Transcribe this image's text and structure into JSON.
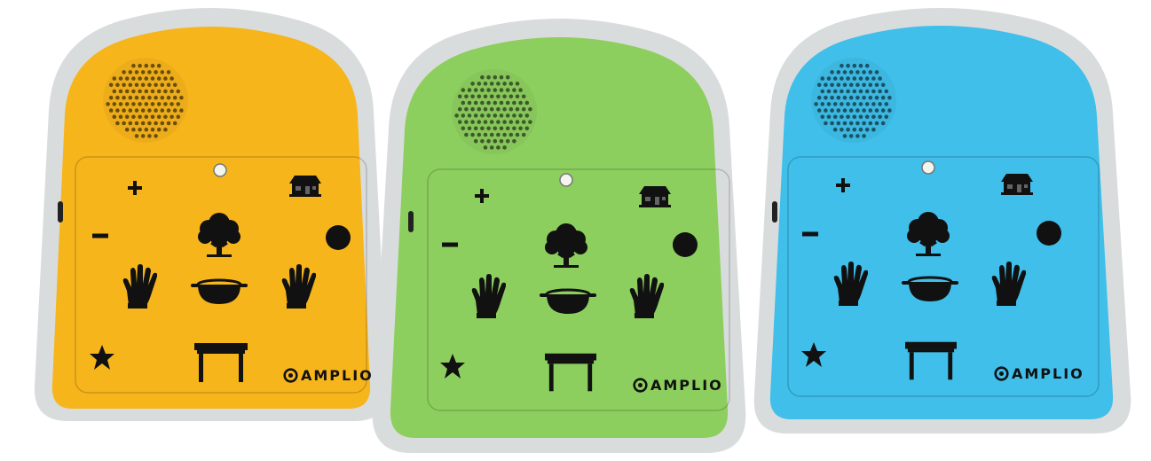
{
  "brand": {
    "name": "AMPLIO",
    "logo_icon": "amplio-logo-icon"
  },
  "devices": [
    {
      "id": "yellow",
      "body_color": "#F7B51C",
      "panel_color": "#F4AE12",
      "position": "left"
    },
    {
      "id": "green",
      "body_color": "#8DCF5E",
      "panel_color": "#86CA57",
      "position": "center"
    },
    {
      "id": "blue",
      "body_color": "#3FBFEA",
      "panel_color": "#36B8E6",
      "position": "right"
    }
  ],
  "frame_color": "#D9DCDD",
  "buttons": [
    {
      "name": "volume-up-button",
      "icon": "plus-icon"
    },
    {
      "name": "volume-down-button",
      "icon": "minus-icon"
    },
    {
      "name": "status-light",
      "icon": "led-icon"
    },
    {
      "name": "home-button",
      "icon": "house-icon"
    },
    {
      "name": "tree-button",
      "icon": "tree-icon"
    },
    {
      "name": "record-button",
      "icon": "dot-icon"
    },
    {
      "name": "left-hand-button",
      "icon": "hand-icon"
    },
    {
      "name": "pot-button",
      "icon": "pot-icon"
    },
    {
      "name": "right-hand-button",
      "icon": "hand-icon"
    },
    {
      "name": "star-button",
      "icon": "star-icon"
    },
    {
      "name": "table-button",
      "icon": "table-icon"
    }
  ]
}
